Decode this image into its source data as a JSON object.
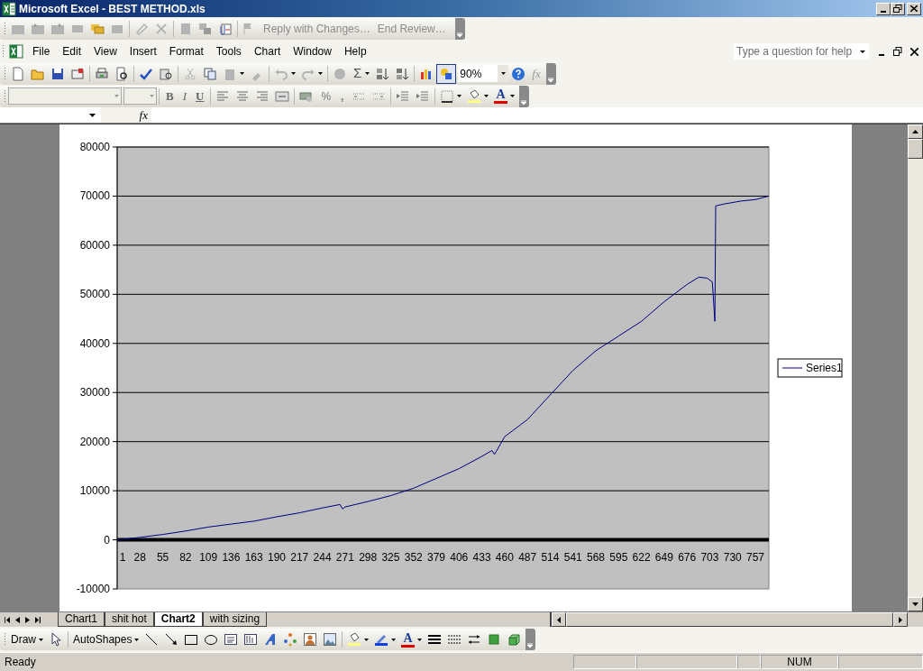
{
  "window": {
    "title": "Microsoft Excel - BEST METHOD.xls"
  },
  "reviewing_toolbar": {
    "buttons": [
      "Reply with Changes…",
      "End Review…"
    ]
  },
  "menu": [
    "File",
    "Edit",
    "View",
    "Insert",
    "Format",
    "Tools",
    "Chart",
    "Window",
    "Help"
  ],
  "help_box": {
    "placeholder": "Type a question for help"
  },
  "standard_toolbar": {
    "autosum": "Σ",
    "zoom": "90%",
    "insert_function": "fx"
  },
  "formatting_toolbar": {
    "bold": "B",
    "italic": "I",
    "underline": "U",
    "percent": "%",
    "comma": ",",
    "font_color": "A"
  },
  "formula_bar": {
    "fx": "fx"
  },
  "chart": {
    "chart_data": {
      "type": "line",
      "grid": true,
      "x": [
        1,
        28,
        55,
        82,
        109,
        136,
        163,
        190,
        217,
        244,
        265,
        268,
        271,
        298,
        325,
        352,
        379,
        406,
        433,
        445,
        448,
        460,
        487,
        514,
        541,
        568,
        595,
        622,
        649,
        676,
        690,
        700,
        706,
        709,
        710,
        720,
        740,
        757,
        773
      ],
      "series": [
        {
          "name": "Series1",
          "color": "#000080",
          "values": [
            0,
            500,
            1100,
            1800,
            2600,
            3200,
            3800,
            4700,
            5500,
            6500,
            7200,
            6300,
            6700,
            7800,
            9000,
            10500,
            12500,
            14500,
            17000,
            18200,
            17400,
            21000,
            24500,
            29500,
            34500,
            38500,
            41500,
            44500,
            48500,
            52000,
            53500,
            53300,
            52500,
            44500,
            68000,
            68400,
            69000,
            69300,
            70000
          ]
        }
      ],
      "xlim": [
        1,
        773
      ],
      "ylim": [
        -10000,
        80000
      ],
      "xticks": [
        1,
        28,
        55,
        82,
        109,
        136,
        163,
        190,
        217,
        244,
        271,
        298,
        325,
        352,
        379,
        406,
        433,
        460,
        487,
        514,
        541,
        568,
        595,
        622,
        649,
        676,
        703,
        730,
        757
      ],
      "yticks": [
        -10000,
        0,
        10000,
        20000,
        30000,
        40000,
        50000,
        60000,
        70000,
        80000
      ]
    }
  },
  "sheet_tabs": [
    {
      "label": "Chart1",
      "selected": false
    },
    {
      "label": "shit hot",
      "selected": false
    },
    {
      "label": "Chart2",
      "selected": true
    },
    {
      "label": "with sizing",
      "selected": false
    }
  ],
  "draw_toolbar": {
    "draw": "Draw",
    "autoshapes": "AutoShapes",
    "font_color": "A"
  },
  "status_bar": {
    "text": "Ready",
    "num": "NUM"
  }
}
